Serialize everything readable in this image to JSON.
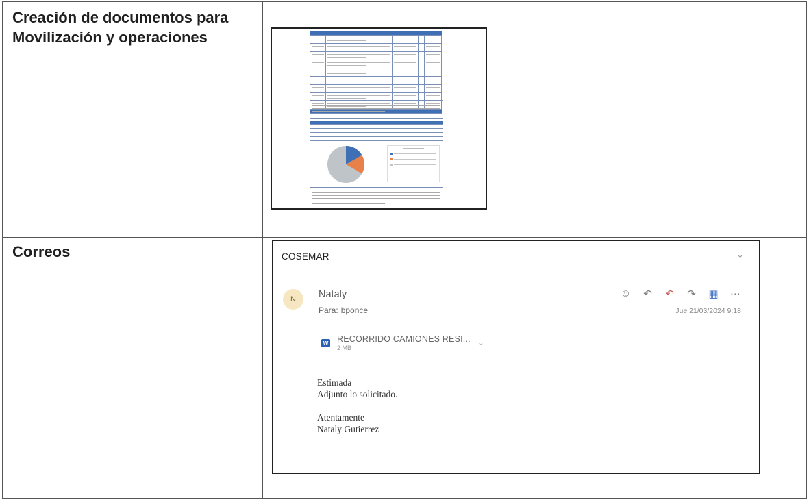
{
  "rows": [
    {
      "title": "Creación de documentos para Movilización y operaciones"
    },
    {
      "title": "Correos"
    }
  ],
  "email": {
    "subject": "COSEMAR",
    "avatar_initial": "N",
    "sender": "Nataly",
    "to_label": "Para:",
    "to_value": "bponce",
    "date": "Jue 21/03/2024 9:18",
    "attachment": {
      "name": "RECORRIDO CAMIONES RESI...",
      "size": "2 MB",
      "icon": "word-file-icon",
      "icon_letter": "W"
    },
    "body": [
      "Estimada",
      "Adjunto lo solicitado.",
      "",
      "Atentamente",
      "Nataly Gutierrez"
    ],
    "actions": [
      "emoji-icon",
      "reply-icon",
      "reply-all-icon",
      "forward-icon",
      "apps-icon",
      "more-icon"
    ]
  },
  "colors": {
    "pie_blue": "#3f6fb5",
    "pie_orange": "#e8804a",
    "pie_gray": "#bfc4c8",
    "table_header": "#3f6fb5"
  }
}
